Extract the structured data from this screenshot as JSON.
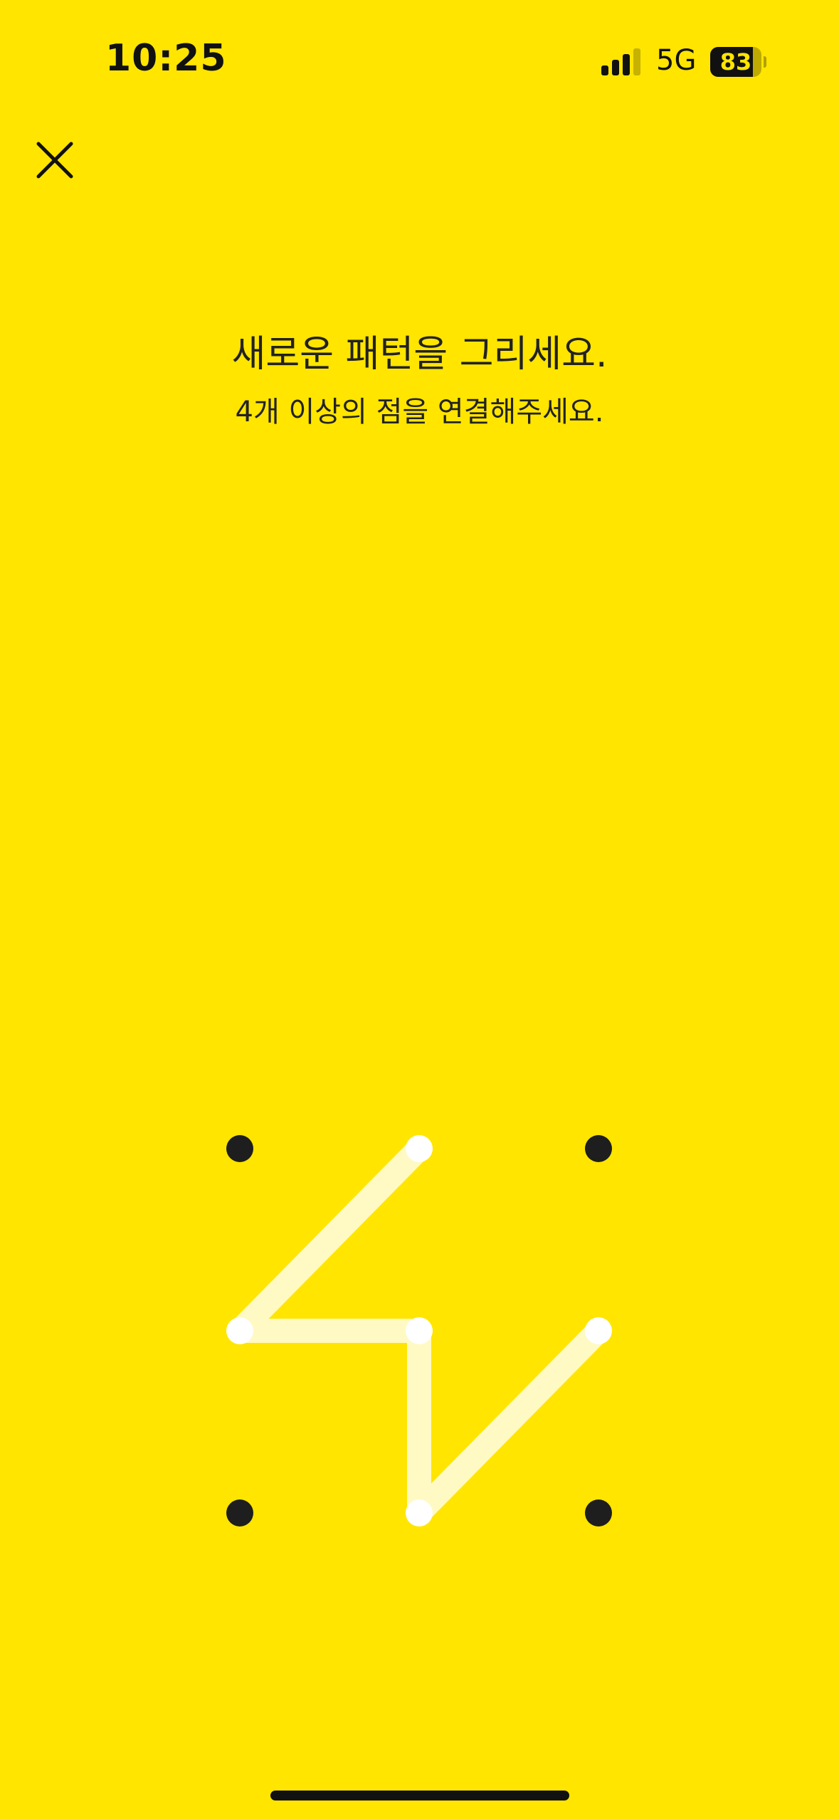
{
  "status_bar": {
    "time": "10:25",
    "network": "5G",
    "battery_level": "83",
    "battery_fraction": 0.83,
    "signal_bars_active": 3,
    "signal_bars_total": 4
  },
  "header": {
    "close_icon": "close-icon"
  },
  "prompt": {
    "title": "새로운 패턴을 그리세요.",
    "subtitle": "4개 이상의 점을 연결해주세요."
  },
  "pattern": {
    "grid_rows": 3,
    "grid_cols": 3,
    "connected_sequence": [
      2,
      4,
      5,
      8,
      6
    ],
    "colors": {
      "dot": "#1e1e1e",
      "active_dot": "#FFFFFF",
      "line": "#FFF9C4"
    }
  },
  "colors": {
    "background": "#FFE500"
  }
}
